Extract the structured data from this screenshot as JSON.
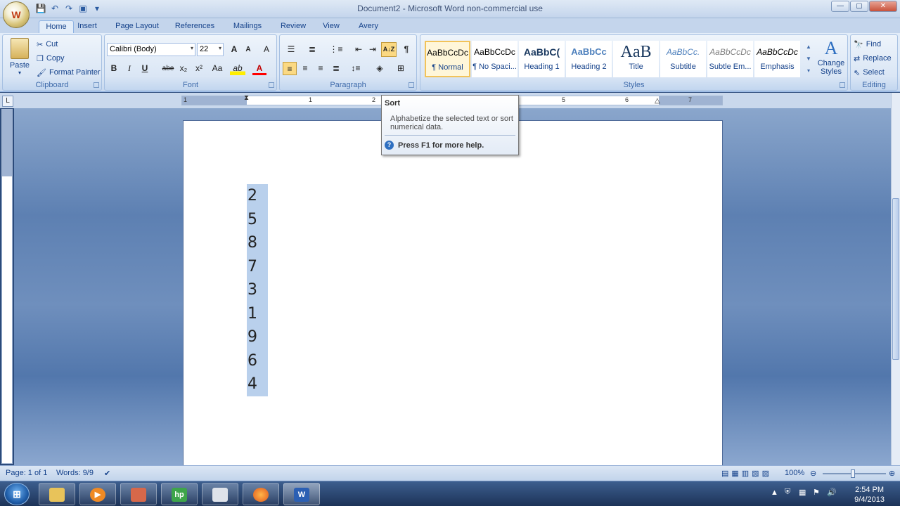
{
  "window": {
    "title": "Document2 - Microsoft Word non-commercial use",
    "office_button_label": "W"
  },
  "tabs": [
    "Home",
    "Insert",
    "Page Layout",
    "References",
    "Mailings",
    "Review",
    "View",
    "Avery"
  ],
  "clipboard": {
    "paste": "Paste",
    "cut": "Cut",
    "copy": "Copy",
    "format_painter": "Format Painter",
    "label": "Clipboard"
  },
  "font": {
    "name": "Calibri (Body)",
    "size": "22",
    "bold": "B",
    "italic": "I",
    "underline": "U",
    "strike": "abe",
    "subscript": "x₂",
    "superscript": "x²",
    "change_case": "Aa",
    "grow": "A",
    "shrink": "A",
    "clear": "A",
    "highlight": "ab",
    "font_color": "A",
    "label": "Font"
  },
  "paragraph": {
    "label": "Paragraph",
    "sort_icon": "A↓Z",
    "pilcrow": "¶"
  },
  "styles": {
    "label": "Styles",
    "items": [
      {
        "preview": "AaBbCcDc",
        "name": "¶ Normal"
      },
      {
        "preview": "AaBbCcDc",
        "name": "¶ No Spaci..."
      },
      {
        "preview": "AaBbC(",
        "name": "Heading 1"
      },
      {
        "preview": "AaBbCc",
        "name": "Heading 2"
      },
      {
        "preview": "AaB",
        "name": "Title"
      },
      {
        "preview": "AaBbCc.",
        "name": "Subtitle"
      },
      {
        "preview": "AaBbCcDc",
        "name": "Subtle Em..."
      },
      {
        "preview": "AaBbCcDc",
        "name": "Emphasis"
      }
    ],
    "change_styles_line1": "Change",
    "change_styles_line2": "Styles"
  },
  "editing": {
    "find": "Find",
    "replace": "Replace",
    "select": "Select",
    "label": "Editing"
  },
  "tooltip": {
    "title": "Sort",
    "body": "Alphabetize the selected text or sort numerical data.",
    "help": "Press F1 for more help."
  },
  "ruler": {
    "ticks": [
      "1",
      "1",
      "2",
      "5",
      "6",
      "7"
    ]
  },
  "document": {
    "numbers": [
      "2",
      "5",
      "8",
      "7",
      "3",
      "1",
      "9",
      "6",
      "4"
    ]
  },
  "status": {
    "page": "Page: 1 of 1",
    "words": "Words: 9/9",
    "zoom": "100%"
  },
  "taskbar": {
    "start_label": "⊞",
    "items": [
      "explorer",
      "media",
      "paint",
      "hp",
      "folder",
      "firefox",
      "word"
    ],
    "labels": [
      "",
      "▶",
      "",
      "hp",
      "",
      "",
      "W"
    ],
    "time": "2:54 PM",
    "date": "9/4/2013"
  },
  "colors": {
    "accent": "#15428b",
    "selection": "#b9d0ec",
    "tooltip_border": "#767676"
  }
}
